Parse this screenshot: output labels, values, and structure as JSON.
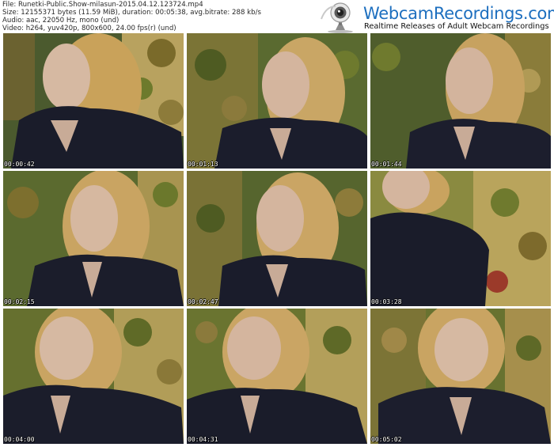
{
  "file_info": {
    "file_line": "File: Runetki-Public.Show-milasun-2015.04.12.123724.mp4",
    "size_line": "Size: 12155371 bytes (11.59 MiB), duration: 00:05:38, avg.bitrate: 288 kb/s",
    "audio_line": "Audio: aac, 22050 Hz, mono (und)",
    "video_line": "Video: h264, yuv420p, 800x600, 24.00 fps(r) (und)"
  },
  "brand": {
    "name": "WebcamRecordings.com",
    "tagline": "Realtime Releases of Adult Webcam Recordings",
    "logo_icon": "webcam-icon",
    "name_color": "#1d6fbf"
  },
  "thumbnails": [
    {
      "timestamp": "00:00:42"
    },
    {
      "timestamp": "00:01:13"
    },
    {
      "timestamp": "00:01:44"
    },
    {
      "timestamp": "00:02:15"
    },
    {
      "timestamp": "00:02:47"
    },
    {
      "timestamp": "00:03:28"
    },
    {
      "timestamp": "00:04:00"
    },
    {
      "timestamp": "00:04:31"
    },
    {
      "timestamp": "00:05:02"
    }
  ]
}
